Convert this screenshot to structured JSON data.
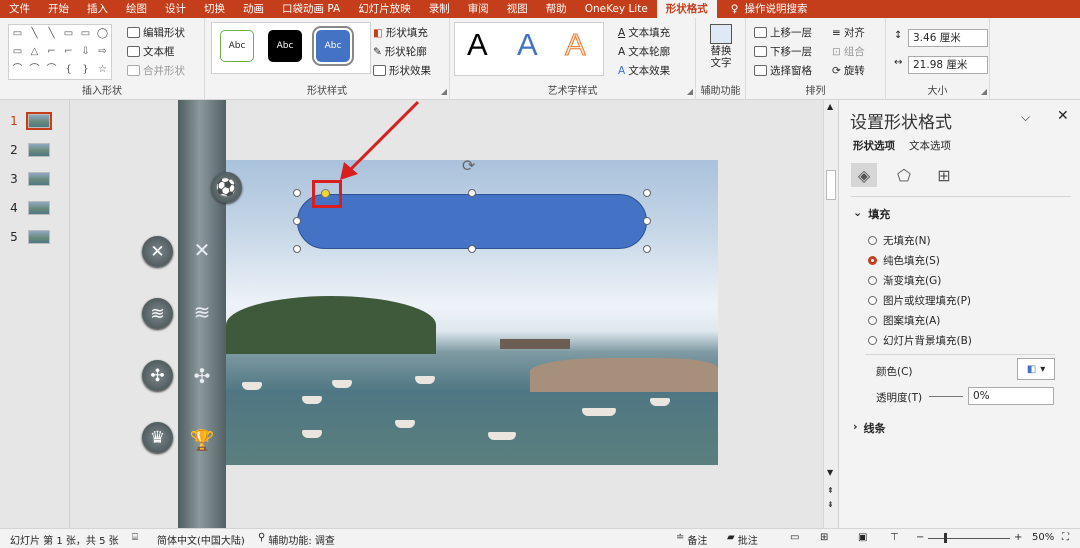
{
  "tabs": [
    "文件",
    "开始",
    "插入",
    "绘图",
    "设计",
    "切换",
    "动画",
    "口袋动画 PA",
    "幻灯片放映",
    "录制",
    "审阅",
    "视图",
    "帮助",
    "OneKey Lite",
    "形状格式"
  ],
  "tell_me": "操作说明搜索",
  "ribbon": {
    "insert_shapes": {
      "label": "插入形状",
      "edit_shape": "编辑形状",
      "text_box": "文本框",
      "merge": "合并形状",
      "shapes": [
        "▭",
        "╲",
        "╲",
        "▭",
        "▭",
        "◯",
        "▭",
        "△",
        "⌐",
        "⌐",
        "⇩",
        "⇨",
        "⌒",
        "⌒",
        "⌒",
        "{",
        "}",
        "☆"
      ]
    },
    "shape_styles": {
      "label": "形状样式",
      "presets": [
        "Abc",
        "Abc",
        "Abc"
      ],
      "fill": "形状填充",
      "outline": "形状轮廓",
      "effects": "形状效果"
    },
    "wordart": {
      "label": "艺术字样式",
      "letters": [
        "A",
        "A",
        "A"
      ],
      "fill": "文本填充",
      "outline": "文本轮廓",
      "effects": "文本效果"
    },
    "accessibility": {
      "label": "辅助功能",
      "alt_text": "替换文字"
    },
    "arrange": {
      "label": "排列",
      "bring_forward": "上移一层",
      "send_backward": "下移一层",
      "selection_pane": "选择窗格",
      "align": "对齐",
      "group": "组合",
      "rotate": "旋转"
    },
    "size": {
      "label": "大小",
      "height": "3.46 厘米",
      "width": "21.98 厘米"
    }
  },
  "thumbnails": [
    "1",
    "2",
    "3",
    "4",
    "5"
  ],
  "slide": {
    "icons_side": [
      "✕",
      "≋",
      "✣",
      "🏆"
    ]
  },
  "pane": {
    "title": "设置形状格式",
    "tabs": [
      "形状选项",
      "文本选项"
    ],
    "fill_section": "填充",
    "fill_options": [
      "无填充(N)",
      "纯色填充(S)",
      "渐变填充(G)",
      "图片或纹理填充(P)",
      "图案填充(A)",
      "幻灯片背景填充(B)"
    ],
    "selected_fill": 1,
    "color_label": "颜色(C)",
    "transparency_label": "透明度(T)",
    "transparency_value": "0%",
    "line_section": "线条"
  },
  "status": {
    "slide_info": "幻灯片 第 1 张，共 5 张",
    "language": "简体中文(中国大陆)",
    "accessibility": "辅助功能: 调查",
    "notes": "备注",
    "comments": "批注",
    "zoom": "50%"
  },
  "colors": {
    "accent": "#c43e1c",
    "shape_fill": "#4472c4",
    "highlight": "#d81e1e"
  }
}
